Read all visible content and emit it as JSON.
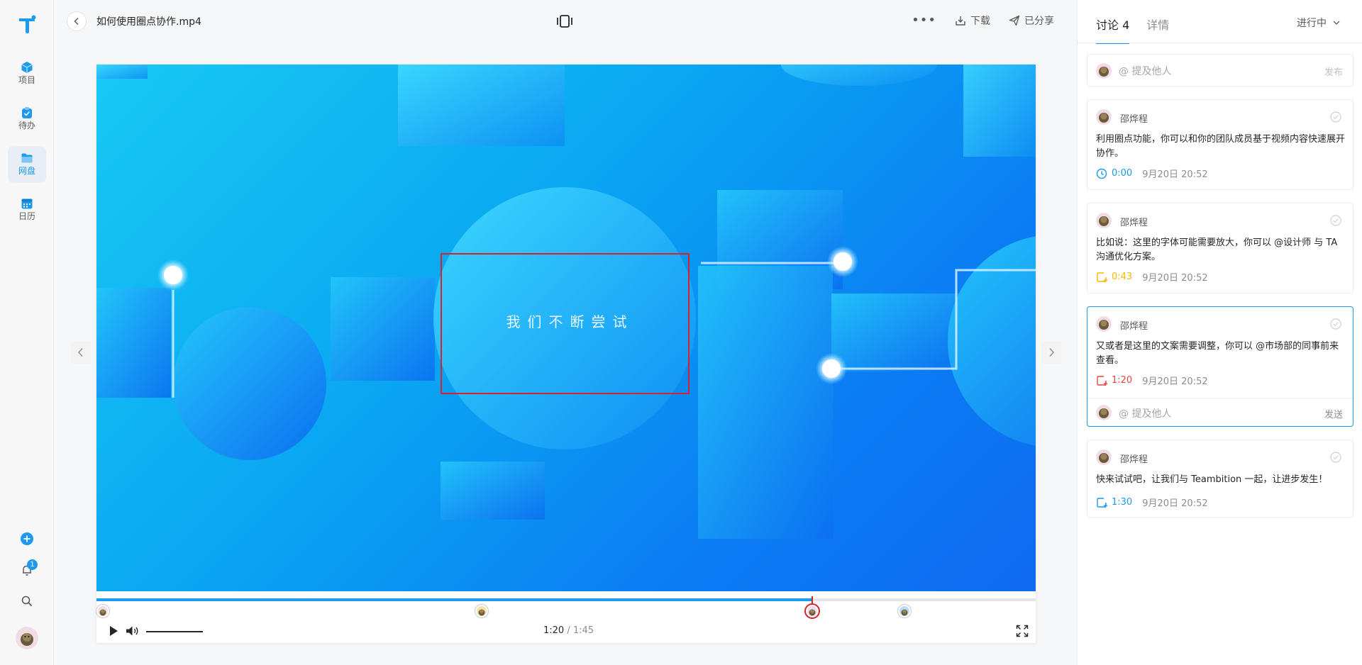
{
  "rail": {
    "nav": [
      {
        "label": "项目"
      },
      {
        "label": "待办"
      },
      {
        "label": "网盘"
      },
      {
        "label": "日历"
      }
    ],
    "notification_count": "1"
  },
  "header": {
    "file_name": "如何使用圈点协作.mp4",
    "download_label": "下载",
    "share_label": "已分享"
  },
  "player": {
    "caption": "我们不断尝试",
    "current_time": "1:20",
    "separator": "/",
    "duration": "1:45",
    "progress_fraction": 0.762,
    "markers": [
      {
        "time": "0:00",
        "fraction": 0.0
      },
      {
        "time": "0:43",
        "fraction": 0.41
      },
      {
        "time": "1:20",
        "fraction": 0.762
      },
      {
        "time": "1:30",
        "fraction": 0.86
      }
    ]
  },
  "panel": {
    "tab_discussion": "讨论",
    "tab_discussion_count": "4",
    "tab_details": "详情",
    "status": "进行中",
    "composer_placeholder": "@ 提及他人",
    "composer_submit": "发布",
    "comments": [
      {
        "author": "邵烨程",
        "text": "利用圈点功能，你可以和你的团队成员基于视频内容快速展开协作。",
        "timestamp": "0:00",
        "date": "9月20日 20:52",
        "ts_color": "#1b9aee"
      },
      {
        "author": "邵烨程",
        "text": "比如说：这里的字体可能需要放大，你可以 @设计师 与 TA 沟通优化方案。",
        "timestamp": "0:43",
        "date": "9月20日 20:52",
        "ts_color": "#f5b800"
      },
      {
        "author": "邵烨程",
        "text": "又或者是这里的文案需要调整，你可以 @市场部的同事前来查看。",
        "timestamp": "1:20",
        "date": "9月20日 20:52",
        "ts_color": "#e54545",
        "reply_placeholder": "@ 提及他人",
        "reply_submit": "发送"
      },
      {
        "author": "邵烨程",
        "text": "快来试试吧，让我们与 Teambition 一起，让进步发生！",
        "timestamp": "1:30",
        "date": "9月20日 20:52",
        "ts_color": "#1b9aee"
      }
    ]
  },
  "colors": {
    "accent": "#1b9aee",
    "annotation": "#d5222b"
  }
}
